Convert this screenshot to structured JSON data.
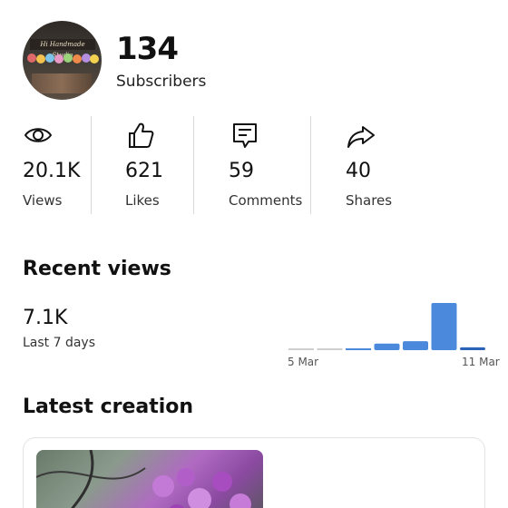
{
  "profile": {
    "avatar_sign_text": "Hi Handmade Studio",
    "subscribers_count": "134",
    "subscribers_label": "Subscribers"
  },
  "stats": [
    {
      "icon": "eye-icon",
      "value": "20.1K",
      "label": "Views"
    },
    {
      "icon": "thumbs-up-icon",
      "value": "621",
      "label": "Likes"
    },
    {
      "icon": "comment-icon",
      "value": "59",
      "label": "Comments"
    },
    {
      "icon": "share-icon",
      "value": "40",
      "label": "Shares"
    }
  ],
  "recent": {
    "title": "Recent views",
    "value": "7.1K",
    "period": "Last 7 days"
  },
  "chart_data": {
    "type": "bar",
    "categories": [
      "",
      "",
      "",
      "",
      "",
      "",
      ""
    ],
    "values": [
      0.02,
      0.02,
      0.03,
      0.14,
      0.19,
      1.0,
      0.06
    ],
    "x_tick_labels": [
      "5 Mar",
      "11 Mar"
    ],
    "colors": {
      "empty": "#cfcfcf",
      "bar": "#4a89dc",
      "last": "#2c62b8"
    }
  },
  "latest": {
    "title": "Latest creation"
  }
}
